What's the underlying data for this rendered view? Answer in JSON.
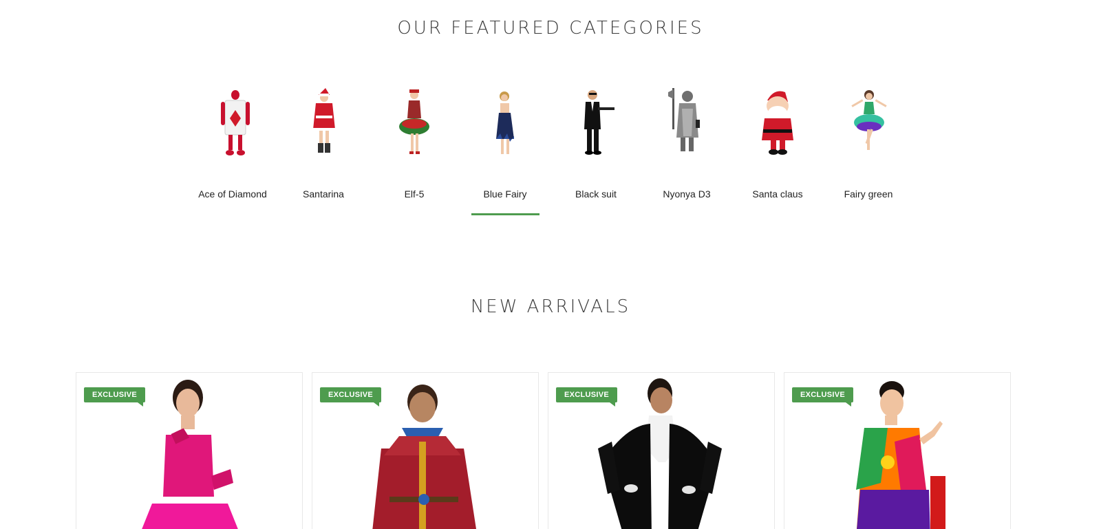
{
  "featured": {
    "title": "OUR FEATURED CATEGORIES",
    "active_index": 3,
    "categories": [
      {
        "label": "Ace of Diamond",
        "icon": "ace-of-diamond-costume-image"
      },
      {
        "label": "Santarina",
        "icon": "santarina-costume-image"
      },
      {
        "label": "Elf-5",
        "icon": "elf-costume-image"
      },
      {
        "label": "Blue Fairy",
        "icon": "blue-fairy-costume-image"
      },
      {
        "label": "Black suit",
        "icon": "black-suit-costume-image"
      },
      {
        "label": "Nyonya D3",
        "icon": "armor-knight-costume-image"
      },
      {
        "label": "Santa claus",
        "icon": "santa-claus-costume-image"
      },
      {
        "label": "Fairy green",
        "icon": "fairy-green-costume-image"
      }
    ]
  },
  "arrivals": {
    "title": "NEW ARRIVALS",
    "products": [
      {
        "badge": "EXCLUSIVE",
        "icon": "pink-sequin-dress-photo"
      },
      {
        "badge": "EXCLUSIVE",
        "icon": "red-medieval-robe-photo"
      },
      {
        "badge": "EXCLUSIVE",
        "icon": "black-tailcoat-photo"
      },
      {
        "badge": "EXCLUSIVE",
        "icon": "colorful-batik-outfit-photo"
      }
    ]
  },
  "colors": {
    "accent": "#4e9c4e",
    "title_text": "#3a3a3a",
    "card_border": "#e8e8e8"
  }
}
